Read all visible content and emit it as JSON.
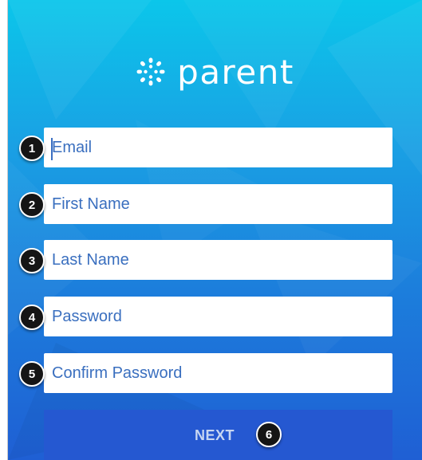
{
  "app": {
    "logo_icon": "canvas-logo-icon",
    "logo_text": "parent"
  },
  "form": {
    "fields": [
      {
        "placeholder": "Email",
        "value": "",
        "badge": "1"
      },
      {
        "placeholder": "First Name",
        "value": "",
        "badge": "2"
      },
      {
        "placeholder": "Last Name",
        "value": "",
        "badge": "3"
      },
      {
        "placeholder": "Password",
        "value": "",
        "badge": "4"
      },
      {
        "placeholder": "Confirm Password",
        "value": "",
        "badge": "5"
      }
    ],
    "next_label": "NEXT",
    "next_badge": "6"
  },
  "colors": {
    "gradient_top": "#0bc6ea",
    "gradient_bottom": "#1f5fd4",
    "button": "#2558d1",
    "placeholder_text": "#3a6fbf",
    "badge_bg": "#151515"
  }
}
